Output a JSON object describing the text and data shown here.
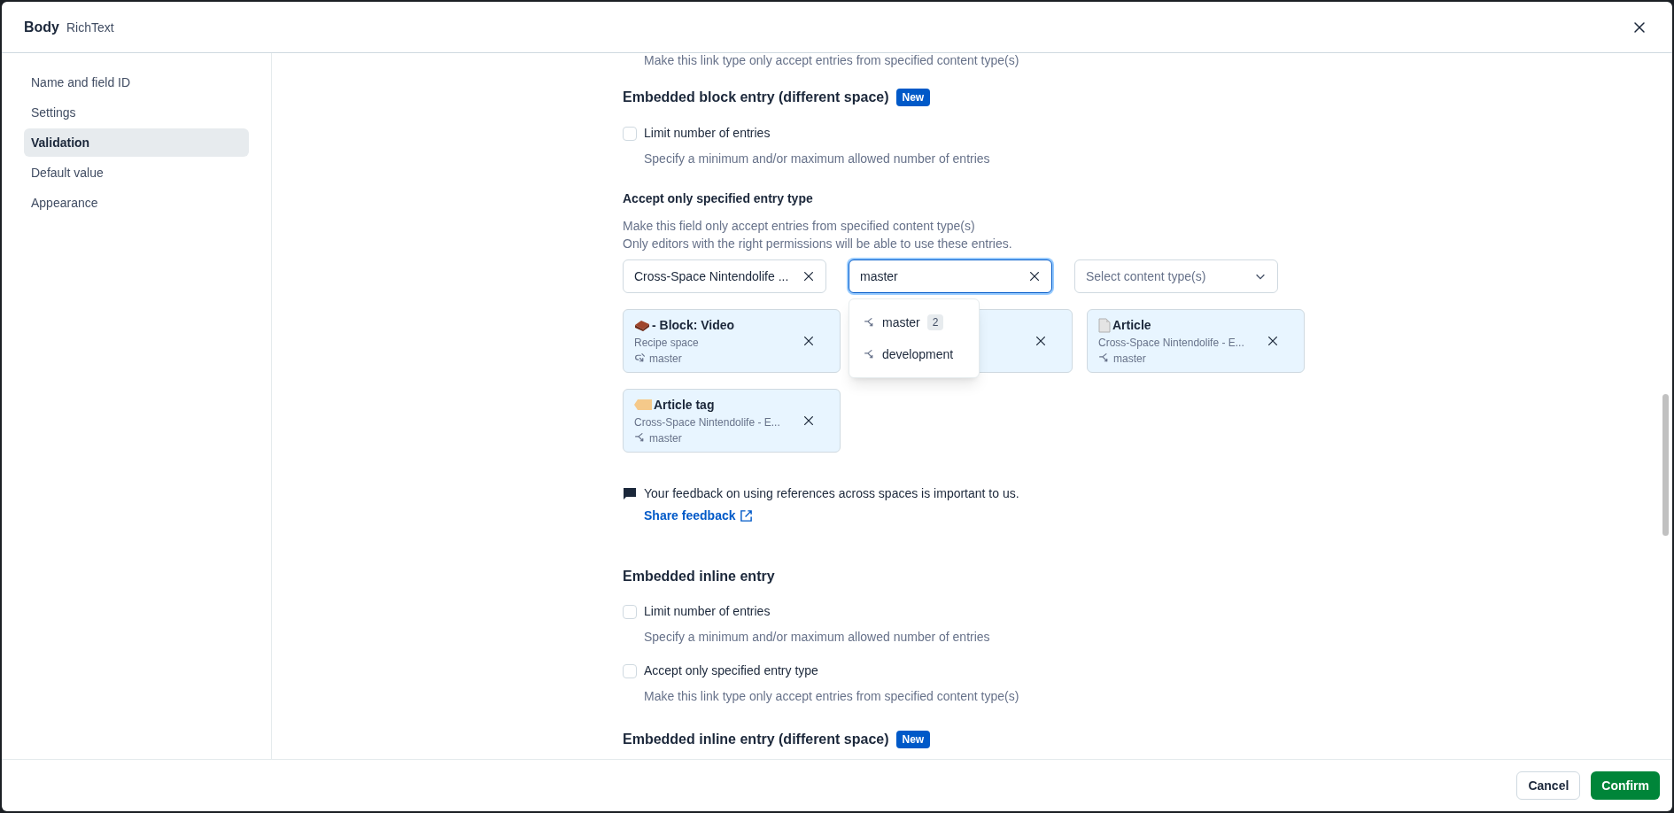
{
  "header": {
    "title": "Body",
    "subtitle": "RichText"
  },
  "sidebar": {
    "items": [
      {
        "label": "Name and field ID",
        "selected": false
      },
      {
        "label": "Settings",
        "selected": false
      },
      {
        "label": "Validation",
        "selected": true
      },
      {
        "label": "Default value",
        "selected": false
      },
      {
        "label": "Appearance",
        "selected": false
      }
    ]
  },
  "top_cut_description": "Make this link type only accept entries from specified content type(s)",
  "section_block": {
    "heading": "Embedded block entry (different space)",
    "badge": "New",
    "limit": {
      "label": "Limit number of entries",
      "checked": false,
      "description": "Specify a minimum and/or maximum allowed number of entries"
    },
    "accept": {
      "label": "Accept only specified entry type",
      "description_lines": [
        "Make this field only accept entries from specified content type(s)",
        "Only editors with the right permissions will be able to use these entries."
      ]
    },
    "space_select": {
      "value": "Cross-Space Nintendolife ..."
    },
    "environment_search": {
      "value": "master",
      "focused": true
    },
    "content_type_select": {
      "placeholder": "Select content type(s)"
    },
    "dropdown": [
      {
        "label": "master",
        "count": "2"
      },
      {
        "label": "development"
      }
    ],
    "cards": [
      {
        "kind": "entry",
        "title": "- Block: Video",
        "space": "Recipe space",
        "env": "master"
      },
      {
        "kind": "covered"
      },
      {
        "kind": "entry",
        "title": "Article",
        "space": "Cross-Space Nintendolife - E...",
        "env": "master"
      },
      {
        "kind": "entry",
        "title": "Article tag",
        "space": "Cross-Space Nintendolife - E...",
        "env": "master"
      }
    ],
    "feedback": {
      "text": "Your feedback on using references across spaces is important to us.",
      "link": "Share feedback"
    }
  },
  "section_inline": {
    "heading": "Embedded inline entry",
    "options": [
      {
        "label": "Limit number of entries",
        "checked": false,
        "description": "Specify a minimum and/or maximum allowed number of entries"
      },
      {
        "label": "Accept only specified entry type",
        "checked": false,
        "description": "Make this link type only accept entries from specified content type(s)"
      }
    ]
  },
  "section_inline_space": {
    "heading": "Embedded inline entry (different space)",
    "badge": "New"
  },
  "footer": {
    "buttons": [
      {
        "label": "Cancel",
        "kind": "secondary"
      },
      {
        "label": "Confirm",
        "kind": "primary"
      }
    ]
  }
}
